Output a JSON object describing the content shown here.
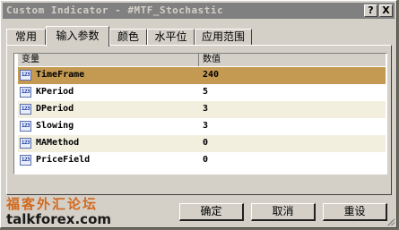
{
  "window": {
    "title": "Custom Indicator - #MTF_Stochastic",
    "help_label": "?",
    "close_label": "X"
  },
  "tabs": [
    {
      "label": "常用"
    },
    {
      "label": "输入参数"
    },
    {
      "label": "颜色"
    },
    {
      "label": "水平位"
    },
    {
      "label": "应用范围"
    }
  ],
  "grid": {
    "headers": {
      "variable": "变量",
      "value": "数值"
    },
    "icon_text": "123",
    "rows": [
      {
        "name": "TimeFrame",
        "value": "240"
      },
      {
        "name": "KPeriod",
        "value": "5"
      },
      {
        "name": "DPeriod",
        "value": "3"
      },
      {
        "name": "Slowing",
        "value": "3"
      },
      {
        "name": "MAMethod",
        "value": "0"
      },
      {
        "name": "PriceField",
        "value": "0"
      }
    ]
  },
  "watermark": {
    "cn": "福客外汇论坛",
    "en": "talkforex.com"
  },
  "buttons": {
    "ok": "确定",
    "cancel": "取消",
    "reset": "重设"
  }
}
